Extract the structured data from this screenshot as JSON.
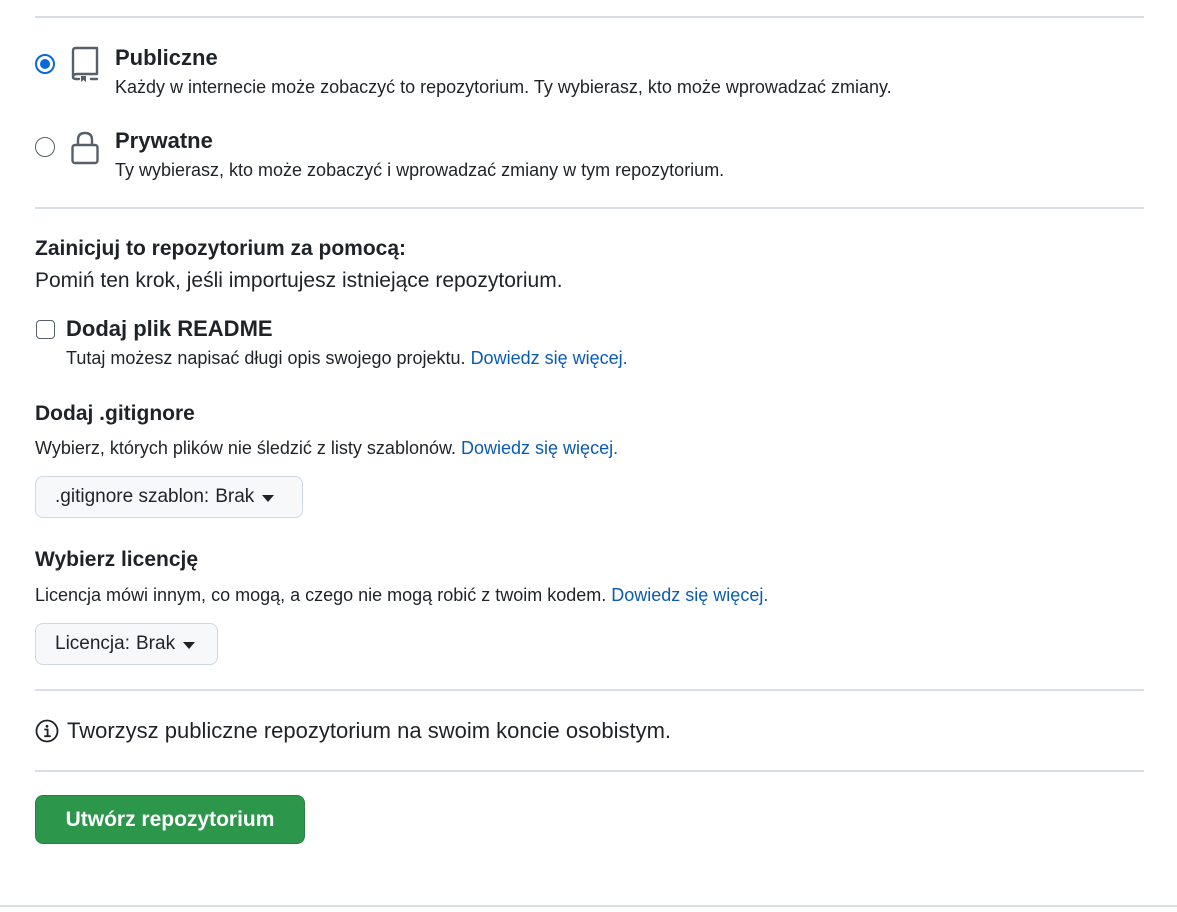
{
  "visibility": {
    "public": {
      "title": "Publiczne",
      "description": "Każdy w internecie może zobaczyć to repozytorium. Ty wybierasz, kto może wprowadzać zmiany.",
      "selected": true,
      "icon": "repo-icon"
    },
    "private": {
      "title": "Prywatne",
      "description": "Ty wybierasz, kto może zobaczyć i wprowadzać zmiany w tym repozytorium.",
      "selected": false,
      "icon": "lock-icon"
    }
  },
  "initialize": {
    "title": "Zainicjuj to repozytorium za pomocą:",
    "subtitle": "Pomiń ten krok, jeśli importujesz istniejące repozytorium.",
    "readme": {
      "label": "Dodaj plik README",
      "checked": false,
      "description": "Tutaj możesz napisać długi opis swojego projektu.",
      "link": "Dowiedz się więcej",
      "after_link": "."
    }
  },
  "gitignore": {
    "title": "Dodaj .gitignore",
    "description": "Wybierz, których plików nie śledzić z listy szablonów.",
    "link": "Dowiedz się więcej",
    "after_link": ".",
    "dropdown_label": ".gitignore szablon:",
    "dropdown_value": "Brak"
  },
  "license": {
    "title": "Wybierz licencję",
    "description": "Licencja mówi innym, co mogą, a czego nie mogą robić z twoim kodem.",
    "link": "Dowiedz się więcej",
    "after_link": ".",
    "dropdown_label": "Licencja:",
    "dropdown_value": "Brak"
  },
  "info": {
    "icon": "info-icon",
    "text": "Tworzysz publiczne repozytorium na swoim koncie osobistym."
  },
  "submit": {
    "label": "Utwórz repozytorium",
    "color": "#2c974b"
  },
  "colors": {
    "accent": "#0969da",
    "link": "#0a5bb5"
  }
}
